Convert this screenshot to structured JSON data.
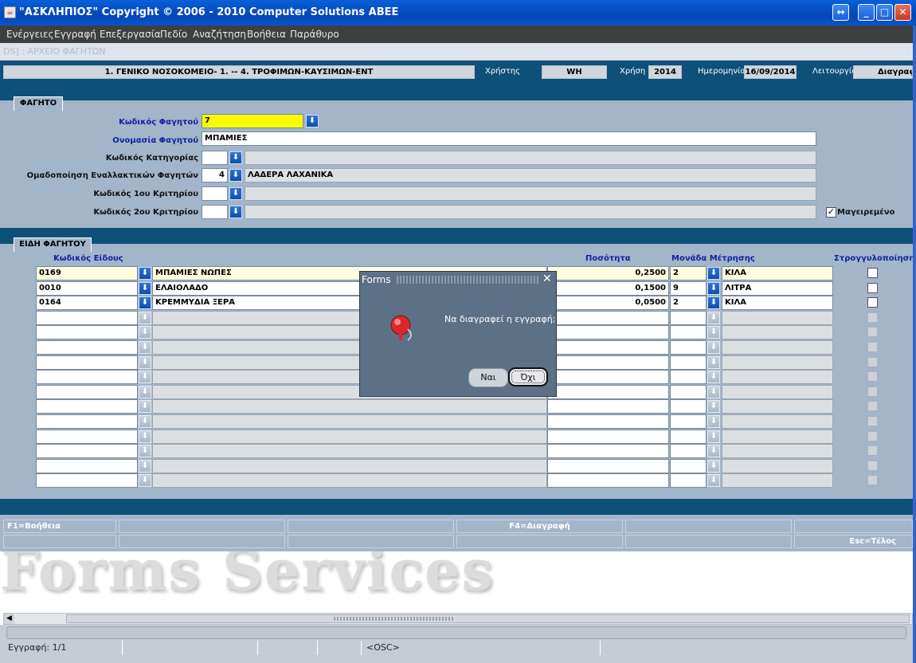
{
  "window": {
    "title": "\"ΑΣΚΛΗΠΙΟΣ\" Copyright © 2006 - 2010 Computer Solutions ΑΒΕΕ"
  },
  "menu": [
    "Ενέργειες",
    "Εγγραφή",
    "Επεξεργασία",
    "Πεδίο",
    "Αναζήτηση",
    "Βοήθεια",
    "Παράθυρο"
  ],
  "path": "DS]   :  ΑΡΧΕΙΟ ΦΑΓΗΤΩΝ",
  "info": {
    "org": "1. ΓΕΝΙΚΟ ΝΟΣΟΚΟΜΕΙΟ- 1. -- 4. ΤΡΟΦΙΜΩΝ-ΚΑΥΣΙΜΩΝ-ΕΝΤ",
    "user_label": "Χρήστης",
    "user": "WH",
    "year_label": "Χρήση",
    "year": "2014",
    "date_label": "Ημερομηνία",
    "date": "16/09/2014",
    "function_label": "Λειτουργία",
    "function": "Διαγραφή"
  },
  "food": {
    "tab": "ΦΑΓΗΤΟ",
    "code_label": "Κωδικός Φαγητού",
    "code": "7",
    "name_label": "Ονομασία Φαγητού",
    "name": "ΜΠΑΜΙΕΣ",
    "category_label": "Κωδικός Κατηγορίας",
    "category": "",
    "category_desc": "",
    "group_label": "Ομαδοποίηση Εναλλακτικών Φαγητών",
    "group": "4",
    "group_desc": "ΛΑΔΕΡΑ ΛΑΧΑΝΙΚΑ",
    "crit1_label": "Κωδικός 1ου Κριτηρίου",
    "crit1": "",
    "crit1_desc": "",
    "crit2_label": "Κωδικός 2ου Κριτηρίου",
    "crit2": "",
    "crit2_desc": "",
    "cooked_label": "Μαγειρεμένο",
    "cooked": true
  },
  "items": {
    "tab": "ΕΙΔΗ ΦΑΓΗΤΟΥ",
    "headers": {
      "code": "Κωδικός Είδους",
      "qty": "Ποσότητα",
      "unit": "Μονάδα Μέτρησης",
      "round": "Στρογγυλοποίηση"
    },
    "rows": [
      {
        "code": "0169",
        "desc": "ΜΠΑΜΙΕΣ ΝΩΠΕΣ",
        "qty": "0,2500",
        "unit": "2",
        "unit_desc": "ΚΙΛΑ"
      },
      {
        "code": "0010",
        "desc": "ΕΛΑΙΟΛΑΔΟ",
        "qty": "0,1500",
        "unit": "9",
        "unit_desc": "ΛΙΤΡΑ"
      },
      {
        "code": "0164",
        "desc": "ΚΡΕΜΜΥΔΙΑ ΞΕΡΑ",
        "qty": "0,0500",
        "unit": "2",
        "unit_desc": "ΚΙΛΑ"
      }
    ],
    "empty_rows": 12
  },
  "fkeys": {
    "help": "F1=Βοήθεια",
    "delete": "F4=Διαγραφή",
    "exit": "Esc=Τέλος"
  },
  "dialog": {
    "title": "Forms",
    "message": "Να διαγραφεί η εγγραφή;",
    "yes": "Ναι",
    "no": "Όχι"
  },
  "watermark": "Forms Services",
  "status": {
    "record": "Εγγραφή: 1/1",
    "osc": "<OSC>"
  }
}
